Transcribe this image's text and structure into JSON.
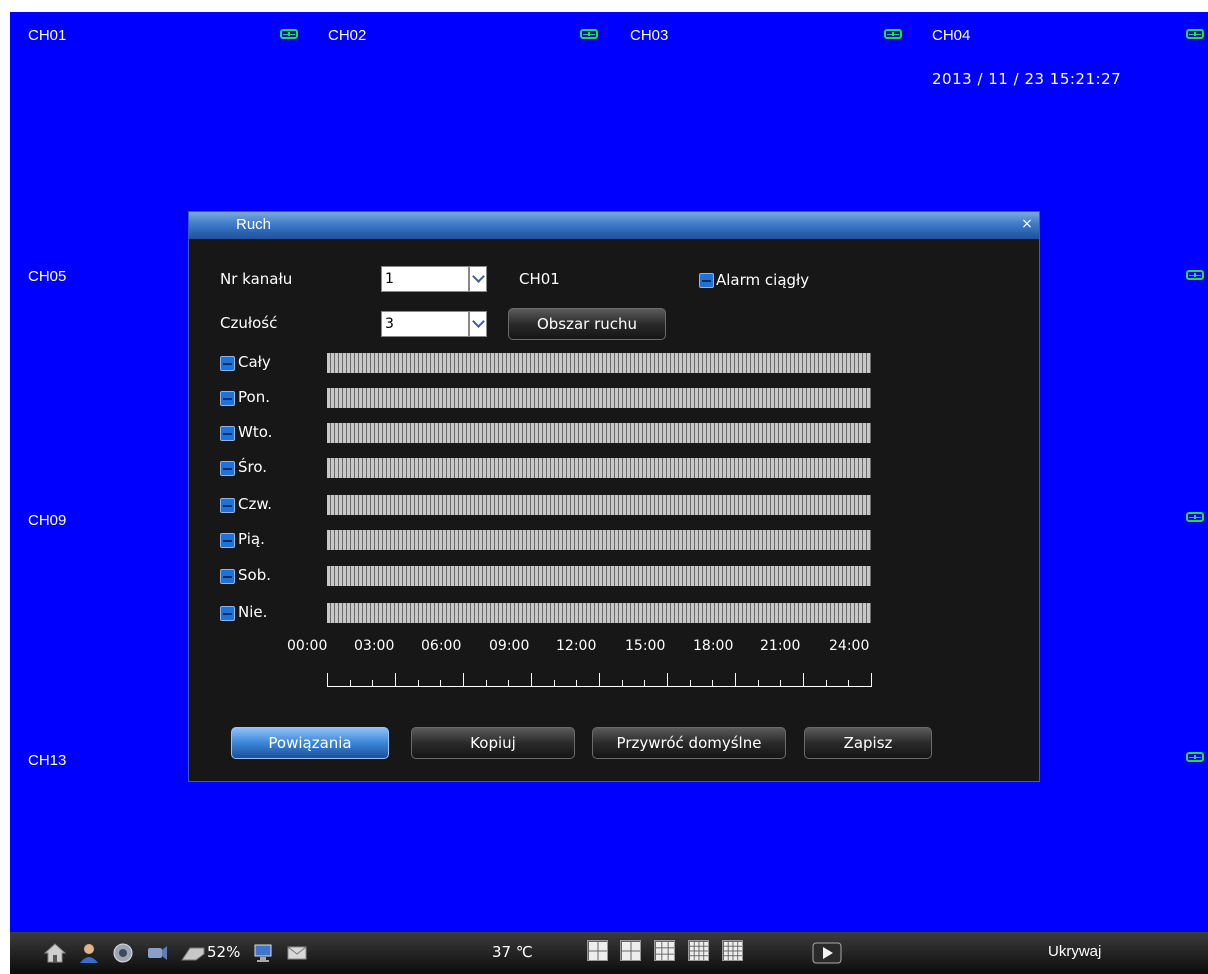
{
  "channels": [
    {
      "label": "CH01",
      "name": "ch01"
    },
    {
      "label": "CH02",
      "name": "ch02"
    },
    {
      "label": "CH03",
      "name": "ch03"
    },
    {
      "label": "CH04",
      "name": "ch04"
    },
    {
      "label": "CH05",
      "name": "ch05"
    },
    {
      "label": "CH09",
      "name": "ch09"
    },
    {
      "label": "CH13",
      "name": "ch13"
    }
  ],
  "datetime": "2013 / 11 / 23 15:21:27",
  "dialog": {
    "title": "Ruch",
    "close_label": "×",
    "channel_label": "Nr kanału",
    "channel_value": "1",
    "channel_name": "CH01",
    "continuous_alarm_label": "Alarm ciągły",
    "sensitivity_label": "Czułość",
    "sensitivity_value": "3",
    "motion_area_button": "Obszar ruchu",
    "days": [
      "Cały",
      "Pon.",
      "Wto.",
      "Śro.",
      "Czw.",
      "Pią.",
      "Sob.",
      "Nie."
    ],
    "time_ticks": [
      "00:00",
      "03:00",
      "06:00",
      "09:00",
      "12:00",
      "15:00",
      "18:00",
      "21:00",
      "24:00"
    ],
    "buttons": {
      "links": "Powiązania",
      "copy": "Kopiuj",
      "restore": "Przywróć domyślne",
      "save": "Zapisz"
    }
  },
  "taskbar": {
    "disk_percent": "52%",
    "temperature": "37 ℃",
    "hide_label": "Ukrywaj"
  },
  "colors": {
    "screen_bg": "#0000ff",
    "dialog_bg": "#171717",
    "rec_icon": "#2be02b",
    "accent_blue": "#3a86d9"
  }
}
